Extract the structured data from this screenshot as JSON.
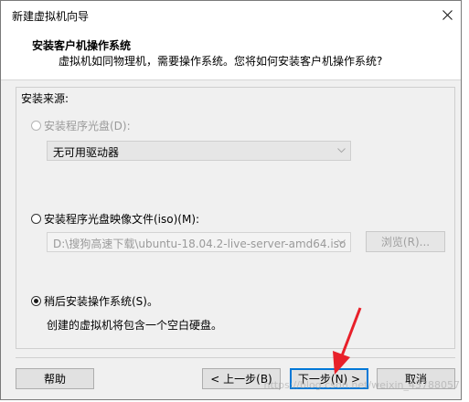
{
  "window": {
    "title": "新建虚拟机向导",
    "close_icon": "close-icon"
  },
  "header": {
    "title": "安装客户机操作系统",
    "subtitle": "虚拟机如同物理机，需要操作系统。您将如何安装客户机操作系统?"
  },
  "source": {
    "label": "安装来源:",
    "options": [
      {
        "label": "安装程序光盘(D):",
        "selected": false,
        "enabled": false,
        "combo_value": "无可用驱动器"
      },
      {
        "label": "安装程序光盘映像文件(iso)(M):",
        "selected": false,
        "enabled": true,
        "combo_value": "D:\\搜狗高速下载\\ubuntu-18.04.2-live-server-amd64.iso",
        "browse_label": "浏览(R)..."
      },
      {
        "label": "稍后安装操作系统(S)。",
        "selected": true,
        "enabled": true,
        "description": "创建的虚拟机将包含一个空白硬盘。"
      }
    ]
  },
  "footer": {
    "help_label": "帮助",
    "back_label": "< 上一步(B)",
    "next_label": "下一步(N) >",
    "cancel_label": "取消"
  },
  "watermark": "https://blog.csdn.net/weixin_43788057",
  "colors": {
    "dialog_bg": "#f0f0f0",
    "header_bg": "#ffffff",
    "accent_border": "#0078d7",
    "annotation_arrow": "#e8202a"
  }
}
